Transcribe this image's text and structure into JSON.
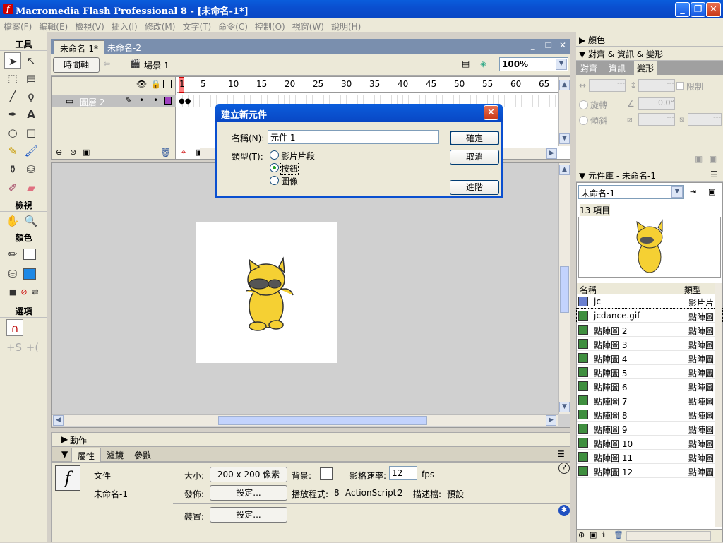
{
  "window": {
    "title": "Macromedia Flash Professional 8 - [未命名-1*]"
  },
  "menu": [
    "檔案(F)",
    "編輯(E)",
    "檢視(V)",
    "插入(I)",
    "修改(M)",
    "文字(T)",
    "命令(C)",
    "控制(O)",
    "視窗(W)",
    "說明(H)"
  ],
  "toolbox": {
    "title": "工具",
    "view": "檢視",
    "colors": "顏色",
    "options": "選項"
  },
  "doc_tabs": [
    "未命名-1*",
    "未命名-2"
  ],
  "editbar": {
    "timeline_button": "時間軸",
    "scene": "場景 1",
    "zoom": "100%"
  },
  "timeline": {
    "layer_name": "圖層 2",
    "ruler": [
      "1",
      "5",
      "10",
      "15",
      "20",
      "25",
      "30",
      "35",
      "40",
      "45",
      "50",
      "55",
      "60",
      "65"
    ]
  },
  "dialog": {
    "title": "建立新元件",
    "name_label": "名稱(N):",
    "name_value": "元件 1",
    "type_label": "類型(T):",
    "types": [
      "影片片段",
      "按鈕",
      "圖像"
    ],
    "selected_type": "按鈕",
    "ok": "確定",
    "cancel": "取消",
    "advanced": "進階"
  },
  "actions_label": "動作",
  "props_tabs": [
    "屬性",
    "濾鏡",
    "參數"
  ],
  "props": {
    "doc_label": "文件",
    "doc_name": "未命名-1",
    "size_label": "大小:",
    "size_value": "200 x 200 像素",
    "bg_label": "背景:",
    "fps_label": "影格速率:",
    "fps_value": "12",
    "fps_unit": "fps",
    "publish_label": "發佈:",
    "settings_btn": "設定...",
    "player_label": "播放程式:",
    "player_value": "8",
    "as_label": "ActionScript:",
    "as_value": "2",
    "profile_label": "描述檔:",
    "profile_value": "預設",
    "device_label": "裝置:",
    "device_btn": "設定..."
  },
  "right": {
    "colors_panel": "顏色",
    "align_panel": "對齊 & 資訊 & 變形",
    "align_tabs": [
      "對齊",
      "資訊",
      "變形"
    ],
    "constrain": "限制",
    "rotate": "旋轉",
    "skew": "傾斜",
    "rotate_value": "0.0°",
    "library_title": "元件庫 - 未命名-1",
    "library_doc": "未命名-1",
    "item_count": "13 項目",
    "col_name": "名稱",
    "col_type": "類型",
    "items": [
      {
        "name": "jc",
        "type": "影片片"
      },
      {
        "name": "jcdance.gif",
        "type": "點陣圖"
      },
      {
        "name": "點陣圖 2",
        "type": "點陣圖"
      },
      {
        "name": "點陣圖 3",
        "type": "點陣圖"
      },
      {
        "name": "點陣圖 4",
        "type": "點陣圖"
      },
      {
        "name": "點陣圖 5",
        "type": "點陣圖"
      },
      {
        "name": "點陣圖 6",
        "type": "點陣圖"
      },
      {
        "name": "點陣圖 7",
        "type": "點陣圖"
      },
      {
        "name": "點陣圖 8",
        "type": "點陣圖"
      },
      {
        "name": "點陣圖 9",
        "type": "點陣圖"
      },
      {
        "name": "點陣圖 10",
        "type": "點陣圖"
      },
      {
        "name": "點陣圖 11",
        "type": "點陣圖"
      },
      {
        "name": "點陣圖 12",
        "type": "點陣圖"
      }
    ]
  }
}
